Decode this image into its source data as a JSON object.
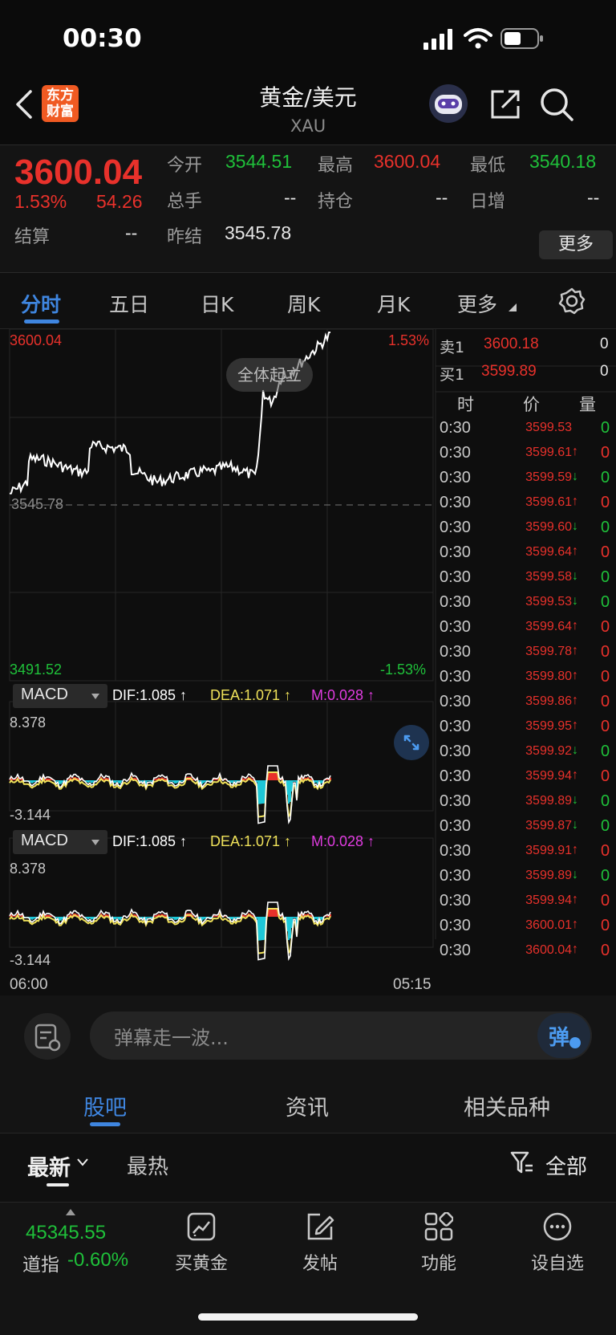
{
  "status_bar": {
    "time": "00:30"
  },
  "nav": {
    "logo_line1": "东方",
    "logo_line2": "财富",
    "title": "黄金/美元",
    "subtitle": "XAU"
  },
  "quote": {
    "price": "3600.04",
    "change_pct": "1.53%",
    "change_amt": "54.26",
    "open_label": "今开",
    "open": "3544.51",
    "high_label": "最高",
    "high": "3600.04",
    "low_label": "最低",
    "low": "3540.18",
    "vol_label": "总手",
    "vol": "--",
    "oi_label": "持仓",
    "oi": "--",
    "daily_inc_label": "日增",
    "daily_inc": "--",
    "settle_label": "结算",
    "settle": "--",
    "prev_settle_label": "昨结",
    "prev_settle": "3545.78",
    "more_label": "更多"
  },
  "tabs": [
    "分时",
    "五日",
    "日K",
    "周K",
    "月K",
    "更多"
  ],
  "chart": {
    "max_price": "3600.04",
    "max_pct": "1.53%",
    "min_price": "3491.52",
    "min_pct": "-1.53%",
    "ref_price": "3545.78",
    "rise_badge": "全体起立",
    "time_start": "06:00",
    "time_end": "05:15",
    "macd": {
      "label": "MACD",
      "dif": "DIF:1.085 ↑",
      "dea": "DEA:1.071 ↑",
      "m": "M:0.028 ↑",
      "max": "8.378",
      "min": "-3.144"
    },
    "colors": {
      "up": "#e8312b",
      "down": "#1fc13a",
      "dif": "#ffffff",
      "dea": "#f0e25a",
      "m": "#e03ce0",
      "macd_neg": "#1ec8d8"
    }
  },
  "order_book": {
    "sell_label": "卖1",
    "sell_price": "3600.18",
    "sell_qty": "0",
    "buy_label": "买1",
    "buy_price": "3599.89",
    "buy_qty": "0",
    "col_time": "时",
    "col_price": "价",
    "col_qty": "量"
  },
  "ticks": [
    {
      "time": "0:30",
      "price": "3599.53",
      "arrow": "",
      "qty": "0",
      "qc": "g"
    },
    {
      "time": "0:30",
      "price": "3599.61",
      "arrow": "↑",
      "qty": "0",
      "qc": "r"
    },
    {
      "time": "0:30",
      "price": "3599.59",
      "arrow": "↓",
      "qty": "0",
      "qc": "g"
    },
    {
      "time": "0:30",
      "price": "3599.61",
      "arrow": "↑",
      "qty": "0",
      "qc": "r"
    },
    {
      "time": "0:30",
      "price": "3599.60",
      "arrow": "↓",
      "qty": "0",
      "qc": "g"
    },
    {
      "time": "0:30",
      "price": "3599.64",
      "arrow": "↑",
      "qty": "0",
      "qc": "r"
    },
    {
      "time": "0:30",
      "price": "3599.58",
      "arrow": "↓",
      "qty": "0",
      "qc": "g"
    },
    {
      "time": "0:30",
      "price": "3599.53",
      "arrow": "↓",
      "qty": "0",
      "qc": "g"
    },
    {
      "time": "0:30",
      "price": "3599.64",
      "arrow": "↑",
      "qty": "0",
      "qc": "r"
    },
    {
      "time": "0:30",
      "price": "3599.78",
      "arrow": "↑",
      "qty": "0",
      "qc": "r"
    },
    {
      "time": "0:30",
      "price": "3599.80",
      "arrow": "↑",
      "qty": "0",
      "qc": "r"
    },
    {
      "time": "0:30",
      "price": "3599.86",
      "arrow": "↑",
      "qty": "0",
      "qc": "r"
    },
    {
      "time": "0:30",
      "price": "3599.95",
      "arrow": "↑",
      "qty": "0",
      "qc": "r"
    },
    {
      "time": "0:30",
      "price": "3599.92",
      "arrow": "↓",
      "qty": "0",
      "qc": "g"
    },
    {
      "time": "0:30",
      "price": "3599.94",
      "arrow": "↑",
      "qty": "0",
      "qc": "r"
    },
    {
      "time": "0:30",
      "price": "3599.89",
      "arrow": "↓",
      "qty": "0",
      "qc": "g"
    },
    {
      "time": "0:30",
      "price": "3599.87",
      "arrow": "↓",
      "qty": "0",
      "qc": "g"
    },
    {
      "time": "0:30",
      "price": "3599.91",
      "arrow": "↑",
      "qty": "0",
      "qc": "r"
    },
    {
      "time": "0:30",
      "price": "3599.89",
      "arrow": "↓",
      "qty": "0",
      "qc": "g"
    },
    {
      "time": "0:30",
      "price": "3599.94",
      "arrow": "↑",
      "qty": "0",
      "qc": "r"
    },
    {
      "time": "0:30",
      "price": "3600.01",
      "arrow": "↑",
      "qty": "0",
      "qc": "r"
    },
    {
      "time": "0:30",
      "price": "3600.04",
      "arrow": "↑",
      "qty": "0",
      "qc": "r"
    }
  ],
  "comment": {
    "placeholder": "弹幕走一波...",
    "danmaku_label": "弹"
  },
  "sections": [
    "股吧",
    "资讯",
    "相关品种"
  ],
  "sort": {
    "latest": "最新",
    "hottest": "最热",
    "filter_all": "全部"
  },
  "bottom_bar": {
    "index_value": "45345.55",
    "index_name": "道指",
    "index_change": "-0.60%",
    "items": [
      "买黄金",
      "发帖",
      "功能",
      "设自选"
    ]
  }
}
